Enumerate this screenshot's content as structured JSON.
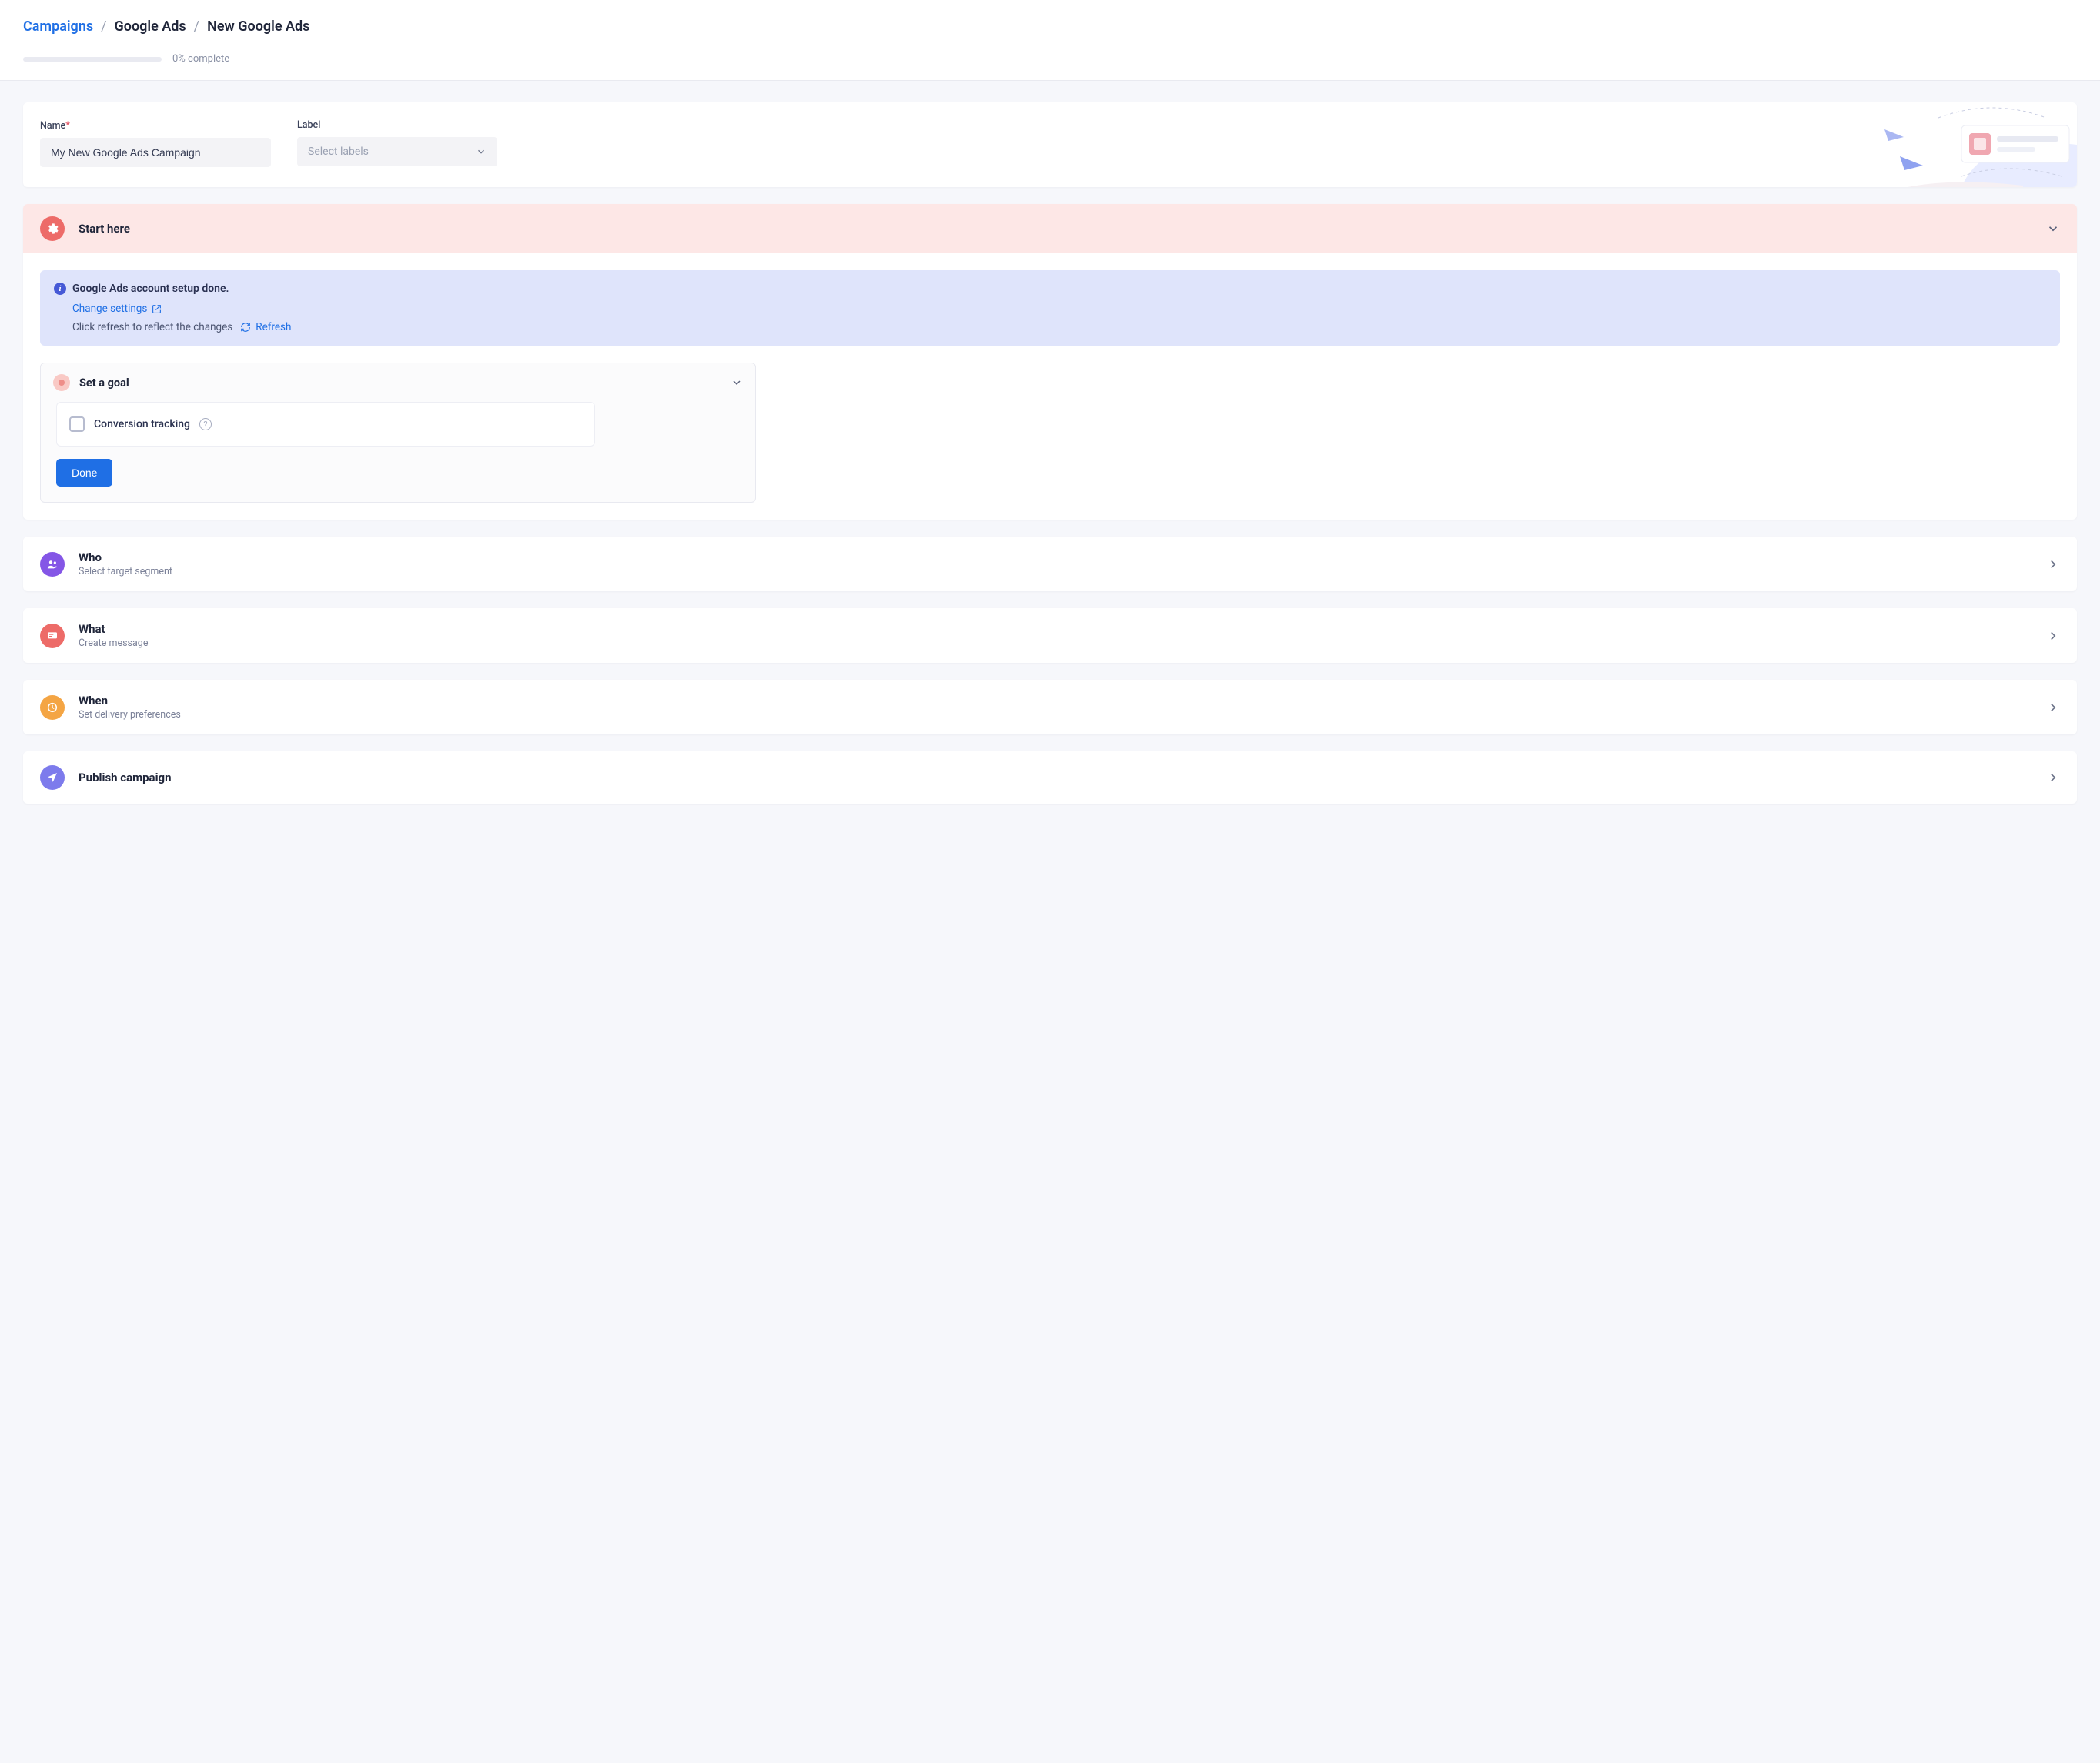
{
  "breadcrumb": {
    "root": "Campaigns",
    "mid": "Google Ads",
    "leaf": "New Google Ads"
  },
  "progress": {
    "label": "0% complete"
  },
  "meta": {
    "name_label": "Name",
    "name_value": "My New Google Ads Campaign",
    "label_label": "Label",
    "label_placeholder": "Select labels"
  },
  "start": {
    "title": "Start here",
    "banner": {
      "msg": "Google Ads account setup done.",
      "change": "Change settings",
      "refresh_hint": "Click refresh to reflect the changes",
      "refresh": "Refresh"
    },
    "goal": {
      "title": "Set a goal",
      "conversion": "Conversion tracking",
      "done": "Done"
    }
  },
  "sections": {
    "who": {
      "title": "Who",
      "sub": "Select target segment"
    },
    "what": {
      "title": "What",
      "sub": "Create message"
    },
    "when": {
      "title": "When",
      "sub": "Set delivery preferences"
    },
    "publish": {
      "title": "Publish campaign"
    }
  },
  "colors": {
    "pink": "#ed6b68",
    "purple": "#8456e6",
    "orange": "#f4a544",
    "violet": "#7d7bec"
  }
}
